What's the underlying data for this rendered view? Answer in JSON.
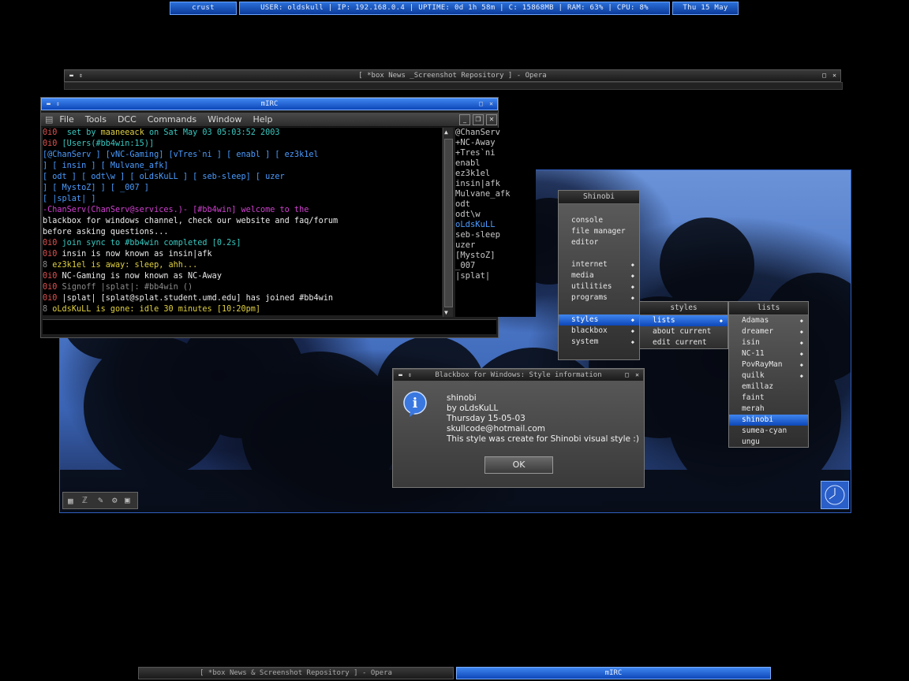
{
  "topbar": {
    "host": "crust",
    "status": "USER: oldskull | IP: 192.168.0.4 | UPTIME: 0d 1h 58m | C: 15868MB | RAM: 63% | CPU: 8%",
    "date": "Thu 15 May"
  },
  "opera": {
    "title": "[ *box News _Screenshot Repository ] - Opera"
  },
  "mirc": {
    "title": "mIRC",
    "menu": [
      "File",
      "Tools",
      "DCC",
      "Commands",
      "Window",
      "Help"
    ],
    "chat": [
      {
        "pre": "0i0",
        "text": "set by ",
        "nick": "maaneeack",
        "rest": " on Sat May 03 05:03:52 2003"
      },
      {
        "pre": "0i0",
        "text": "[Users(#bb4win:15)]"
      },
      {
        "text": "[@ChanServ ] [vNC-Gaming] [vTres`ni ] [ enabl    ] [ ez3k1el"
      },
      {
        "text": "] [ insin    ] [ Mulvane_afk]"
      },
      {
        "text": "[ odt      ] [ odt\\w    ] [ oLdsKuLL ] [ seb-sleep] [ uzer"
      },
      {
        "text": "] [ MystoZ] ] [ _007     ]"
      },
      {
        "text": "[ |splat|  ]"
      },
      {
        "text": "-ChanServ(ChanServ@services.)- [#bb4win] welcome to the"
      },
      {
        "text": "blackbox for windows channel, check our website and faq/forum"
      },
      {
        "text": "before asking questions..."
      },
      {
        "pre": "0i0",
        "text": "join sync to #bb4win completed [0.2s]"
      },
      {
        "pre": "0i0",
        "text": "insin is now known as insin|afk"
      },
      {
        "pre": "8",
        "text": "ez3k1el is away: sleep, ahh..."
      },
      {
        "pre": "0i0",
        "text": "NC-Gaming is now known as NC-Away"
      },
      {
        "pre": "0i0",
        "text": "Signoff |splat|: #bb4win ()"
      },
      {
        "pre": "0i0",
        "text": "|splat| [splat@splat.student.umd.edu] has joined #bb4win"
      },
      {
        "pre": "8",
        "text": "oLdsKuLL is gone: idle 30 minutes [10:20pm]"
      }
    ],
    "nicks": [
      "@ChanServ",
      "+NC-Away",
      "+Tres`ni",
      "enabl",
      "ez3k1el",
      "insin|afk",
      "Mulvane_afk",
      "odt",
      "odt\\w",
      "oLdsKuLL",
      "seb-sleep",
      "uzer",
      "[MystoZ]",
      "_007",
      "|splat|"
    ]
  },
  "menu_main": {
    "title": "Shinobi",
    "items": [
      "console",
      "file manager",
      "editor",
      "",
      "internet",
      "media",
      "utilities",
      "programs",
      "",
      "styles",
      "blackbox",
      "system"
    ]
  },
  "menu_styles": {
    "title": "styles",
    "items": [
      "lists",
      "about current",
      "edit current"
    ]
  },
  "menu_lists": {
    "title": "lists",
    "items": [
      "Adamas",
      "dreamer",
      "isin",
      "NC-11",
      "PovRayMan",
      "quilk",
      "emillaz",
      "faint",
      "merah",
      "shinobi",
      "sumea-cyan",
      "ungu"
    ]
  },
  "dialog": {
    "title": "Blackbox for Windows: Style information",
    "lines": [
      "shinobi",
      "by oLdsKuLL",
      "Thursday 15-05-03",
      "skullcode@hotmail.com",
      "This style was create for Shinobi visual style :)"
    ],
    "ok": "OK"
  },
  "taskbar": {
    "opera": "[ *box News & Screenshot Repository ] - Opera",
    "mirc": "mIRC"
  }
}
